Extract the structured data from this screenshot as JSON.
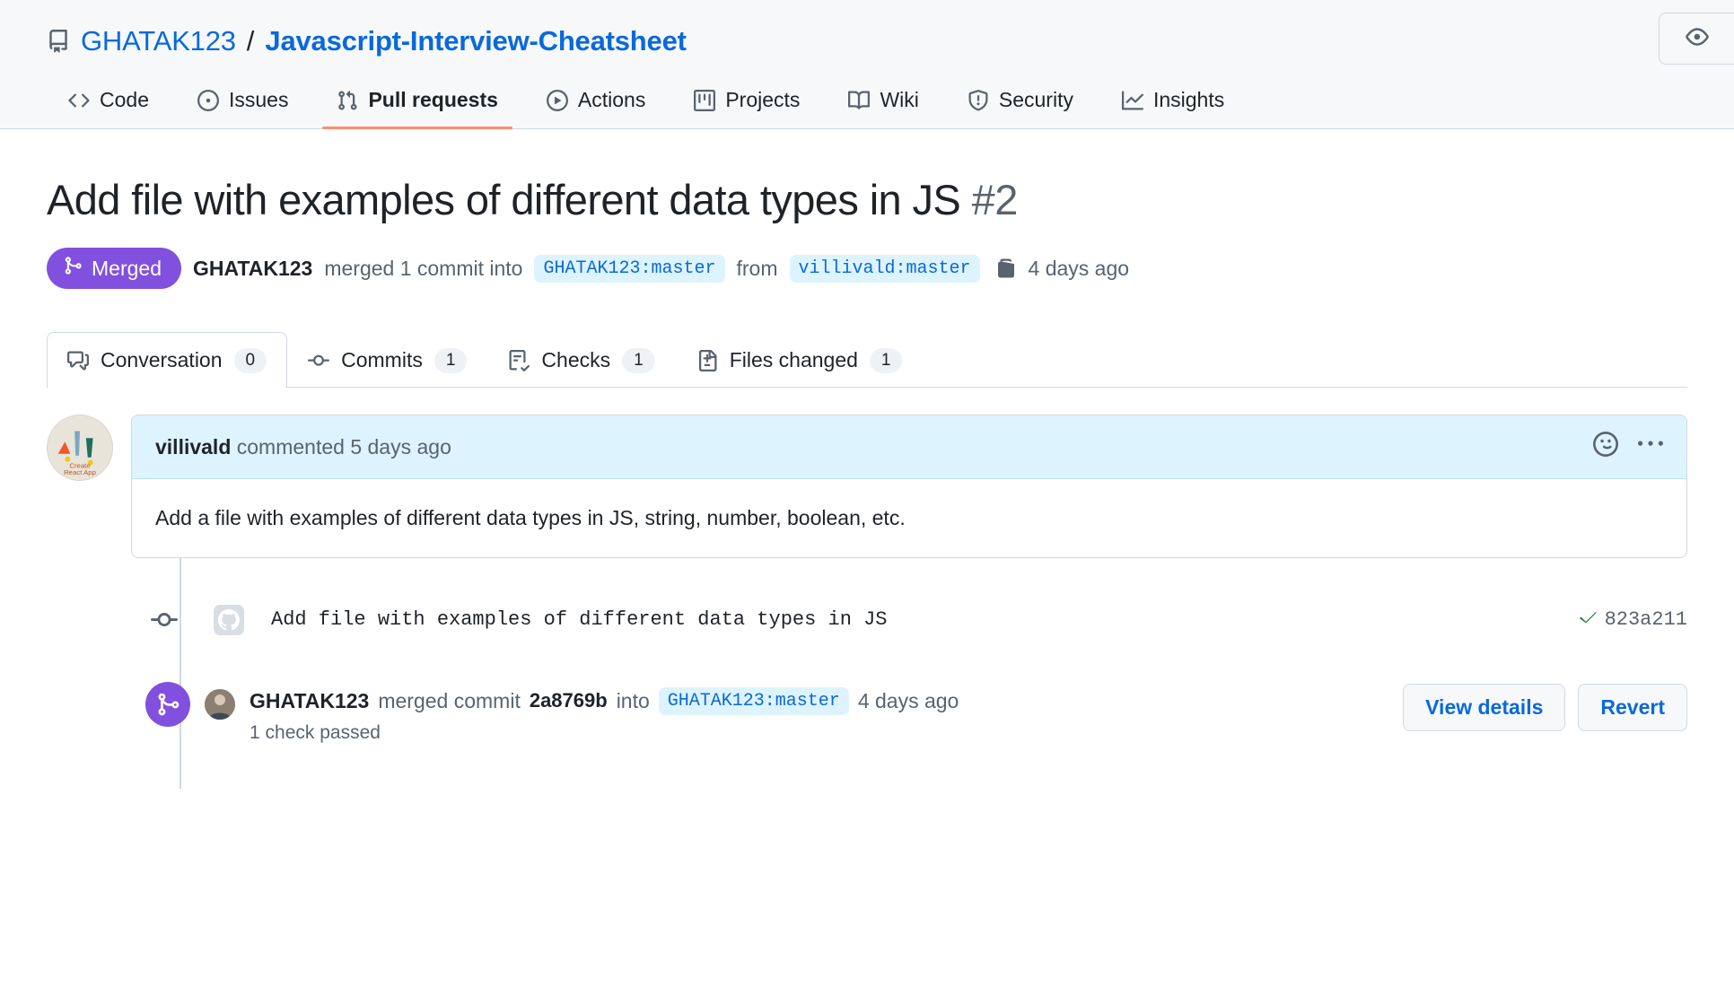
{
  "repo": {
    "owner": "GHATAK123",
    "separator": "/",
    "name": "Javascript-Interview-Cheatsheet",
    "repo_icon": "repo-icon",
    "watch_icon": "eye-icon"
  },
  "nav": {
    "tabs": [
      {
        "label": "Code",
        "icon": "code-icon",
        "active": false
      },
      {
        "label": "Issues",
        "icon": "issue-opened-icon",
        "active": false
      },
      {
        "label": "Pull requests",
        "icon": "git-pull-request-icon",
        "active": true
      },
      {
        "label": "Actions",
        "icon": "play-icon",
        "active": false
      },
      {
        "label": "Projects",
        "icon": "project-icon",
        "active": false
      },
      {
        "label": "Wiki",
        "icon": "book-icon",
        "active": false
      },
      {
        "label": "Security",
        "icon": "shield-icon",
        "active": false
      },
      {
        "label": "Insights",
        "icon": "graph-icon",
        "active": false
      }
    ]
  },
  "pull_request": {
    "title": "Add file with examples of different data types in JS",
    "number": "#2",
    "state": "Merged",
    "state_icon": "git-merge-icon",
    "state_color": "#8250df",
    "merged_by": "GHATAK123",
    "merge_text_1": "merged 1 commit into",
    "base_branch": "GHATAK123:master",
    "merge_text_2": "from",
    "head_branch": "villivald:master",
    "copy_icon": "copy-icon",
    "merged_when": "4 days ago"
  },
  "subtabs": [
    {
      "label": "Conversation",
      "count": "0",
      "icon": "comment-discussion-icon",
      "active": true
    },
    {
      "label": "Commits",
      "count": "1",
      "icon": "git-commit-icon",
      "active": false
    },
    {
      "label": "Checks",
      "count": "1",
      "icon": "checklist-icon",
      "active": false
    },
    {
      "label": "Files changed",
      "count": "1",
      "icon": "file-diff-icon",
      "active": false
    }
  ],
  "comment": {
    "author": "villivald",
    "action": "commented",
    "when": "5 days ago",
    "body": "Add a file with examples of different data types in JS, string, number, boolean, etc.",
    "reaction_icon": "smiley-icon",
    "menu_icon": "kebab-horizontal-icon",
    "avatar_name": "avatar-villivald"
  },
  "commit_event": {
    "avatar_name": "github-avatar-icon",
    "message": "Add file with examples of different data types in JS",
    "status_icon": "check-icon",
    "sha": "823a211"
  },
  "merge_event": {
    "badge_icon": "git-merge-icon",
    "avatar_name": "avatar-ghatak123",
    "user": "GHATAK123",
    "text_1": "merged commit",
    "sha": "2a8769b",
    "text_2": "into",
    "branch": "GHATAK123:master",
    "when": "4 days ago",
    "checks_note": "1 check passed",
    "view_details_label": "View details",
    "revert_label": "Revert"
  }
}
